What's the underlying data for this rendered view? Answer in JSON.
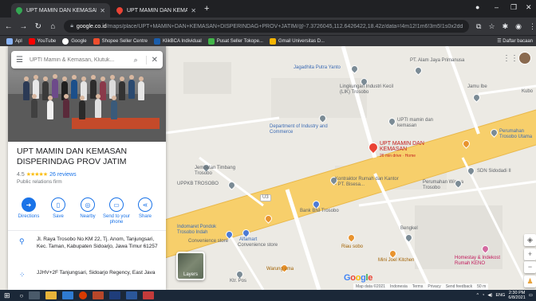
{
  "browser": {
    "tabs": [
      {
        "title": "UPT MAMIN DAN KEMASAN DIS",
        "active": true
      },
      {
        "title": "UPT MAMIN DAN KEMASAN: Pi",
        "active": false
      }
    ],
    "new_tab": "+",
    "url_domain": "google.co.id",
    "url_path": "/maps/place/UPT+MAMIN+DAN+KEMASAN+DISPERINDAG+PROV+JATIM/@-7.3726045,112.6426422,18.42z/data=!4m12!1m6!3m5!1s0x2dd7e297089128...",
    "bookmarks": [
      "Apl",
      "YouTube",
      "Google",
      "Shopee Seller Centre",
      "KlikBCA Individual",
      "Pusat Seller Tokope...",
      "Gmail Universitas D..."
    ],
    "bookmarks_right": "Daftar bacaan"
  },
  "panel": {
    "search_placeholder": "UPTI Mamin & Kemasan, Klutuk...",
    "place_title": "UPT MAMIN DAN KEMASAN DISPERINDAG PROV JATIM",
    "rating": "4.5",
    "stars": "★★★★★",
    "reviews": "26 reviews",
    "category": "Public relations firm",
    "actions": [
      {
        "label": "Directions",
        "icon": "directions-icon"
      },
      {
        "label": "Save",
        "icon": "bookmark-icon"
      },
      {
        "label": "Nearby",
        "icon": "nearby-icon"
      },
      {
        "label": "Send to your phone",
        "icon": "phone-icon"
      },
      {
        "label": "Share",
        "icon": "share-icon"
      }
    ],
    "address": "Jl. Raya Trosobo No.KM 22, Tj. Anom, Tanjungsari, Kec. Taman, Kabupaten Sidoarjo, Jawa Timur 61257",
    "plus_code": "JJHV+2F Tanjungsari, Sidoarjo Regency, East Java"
  },
  "map": {
    "labels": {
      "jagadhita": "Jagadhita Putra Yanto",
      "alam_jaya": "PT. Alam Jaya Primanusa",
      "lingkungan": "Lingkungan Industri Kecil (LIK) Trosobo",
      "jamu": "Jamu Ibe",
      "kubo": "Kubo",
      "dept": "Department of Industry and Commerce",
      "upti": "UPTI mamin dan kemasan",
      "main_place": "UPT MAMIN DAN KEMASAN",
      "main_place_sub": "26 min drive · Home",
      "perumahan_trosobo": "Perumahan Trosobo Utama",
      "jembatan": "Jembatan Timbang Trosobo",
      "uppkb": "UPPKB TROSOBO",
      "kontraktor": "Kontraktor Rumah dan Kantor - PT. Bisesa...",
      "sdn": "SDN Sidodadi II",
      "wisma": "Perumahan Wisma Trosobo",
      "bni": "Bank BNI Trosobo",
      "indomaret": "Indomaret Pondok Trosobo Indah",
      "indomaret_sub": "Convenience store",
      "alfamart": "Alfamart",
      "alfamart_sub": "Convenience store",
      "bengkel": "Bengkel",
      "riau": "Riau sobo",
      "minijoel": "Mini Joel Kitchen",
      "homestay": "Homestay & Indekost Rumah KENO",
      "warung": "Warung uma",
      "ktr_pos": "Ktr. Pos",
      "road": "U3"
    },
    "layers_label": "Layers",
    "google_logo": "Google",
    "attribution": [
      "Map data ©2021",
      "Indonesia",
      "Terms",
      "Privacy",
      "Send feedback",
      "50 m"
    ]
  },
  "taskbar": {
    "lang": "ENG",
    "time": "2:30 PM",
    "date": "6/8/2021"
  }
}
